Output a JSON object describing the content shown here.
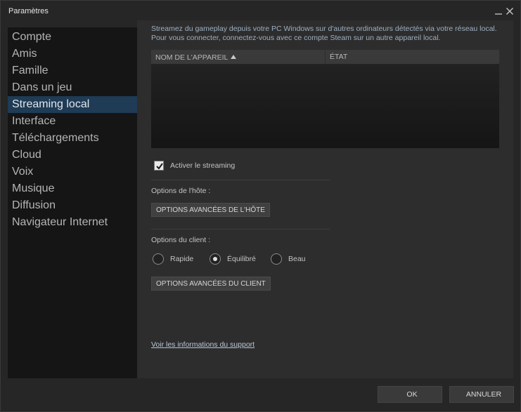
{
  "window": {
    "title": "Paramètres"
  },
  "sidebar": {
    "items": [
      {
        "label": "Compte"
      },
      {
        "label": "Amis"
      },
      {
        "label": "Famille"
      },
      {
        "label": "Dans un jeu"
      },
      {
        "label": "Streaming local",
        "active": true
      },
      {
        "label": "Interface"
      },
      {
        "label": "Téléchargements"
      },
      {
        "label": "Cloud"
      },
      {
        "label": "Voix"
      },
      {
        "label": "Musique"
      },
      {
        "label": "Diffusion"
      },
      {
        "label": "Navigateur Internet"
      }
    ]
  },
  "main": {
    "description": "Streamez du gameplay depuis votre PC Windows sur d'autres ordinateurs détectés via votre réseau local. Pour vous connecter, connectez-vous avec ce compte Steam sur un autre appareil local.",
    "table": {
      "columns": [
        "NOM DE L'APPAREIL",
        "ÉTAT"
      ],
      "rows": []
    },
    "enable_streaming": {
      "label": "Activer le streaming",
      "checked": true
    },
    "host_options": {
      "label": "Options de l'hôte :",
      "button": "OPTIONS AVANCÉES DE L'HÔTE"
    },
    "client_options": {
      "label": "Options du client :",
      "radios": [
        {
          "label": "Rapide",
          "checked": false
        },
        {
          "label": "Équilibré",
          "checked": true
        },
        {
          "label": "Beau",
          "checked": false
        }
      ],
      "button": "OPTIONS AVANCÉES DU CLIENT"
    },
    "support_link": "Voir les informations du support"
  },
  "footer": {
    "ok": "OK",
    "cancel": "ANNULER"
  },
  "icons": {
    "minimize": "minimize-icon",
    "close": "close-icon",
    "sort": "sort-ascending-icon",
    "check": "checkmark-icon"
  },
  "colors": {
    "active_item": "#1f3b55",
    "background": "#262626",
    "panel": "#2d2d2d"
  }
}
